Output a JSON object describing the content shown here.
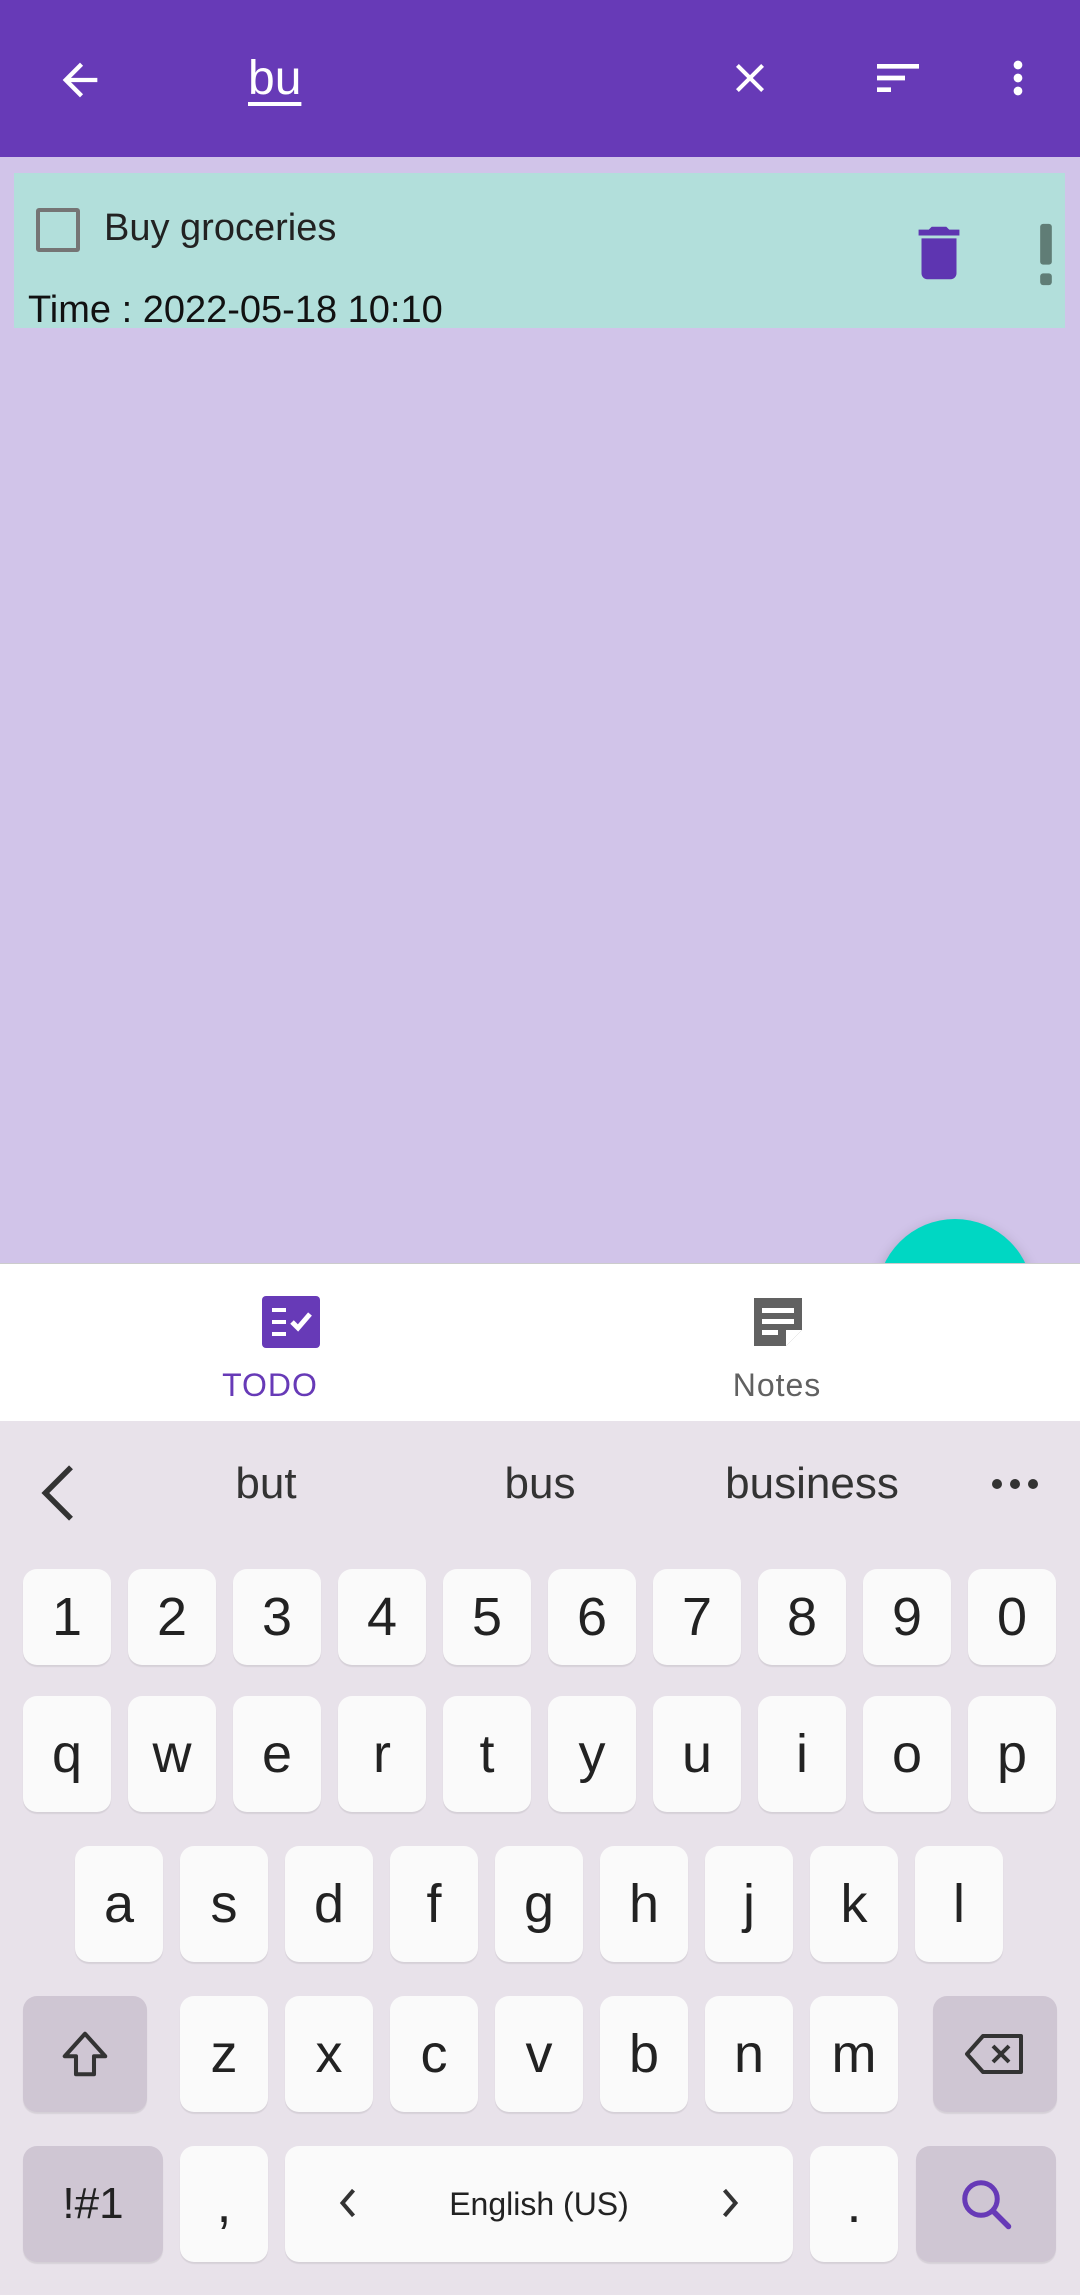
{
  "appbar": {
    "search_query": "bu",
    "icons": [
      "back-arrow-icon",
      "close-icon",
      "sort-icon",
      "more-vert-icon"
    ]
  },
  "todo_items": [
    {
      "title": "Buy groceries",
      "time": "Time : 2022-05-18 10:10",
      "checked": false
    }
  ],
  "bottom_nav": {
    "items": [
      {
        "label": "TODO",
        "active": true,
        "icon": "checklist-icon"
      },
      {
        "label": "Notes",
        "active": false,
        "icon": "note-icon"
      }
    ]
  },
  "keyboard": {
    "suggestions": [
      "but",
      "bus",
      "business"
    ],
    "row_numbers": [
      "1",
      "2",
      "3",
      "4",
      "5",
      "6",
      "7",
      "8",
      "9",
      "0"
    ],
    "row_q": [
      "q",
      "w",
      "e",
      "r",
      "t",
      "y",
      "u",
      "i",
      "o",
      "p"
    ],
    "row_a": [
      "a",
      "s",
      "d",
      "f",
      "g",
      "h",
      "j",
      "k",
      "l"
    ],
    "row_z": [
      "z",
      "x",
      "c",
      "v",
      "b",
      "n",
      "m"
    ],
    "symbols_label": "!#1",
    "comma": ",",
    "period": ".",
    "language_label": "English (US)"
  },
  "colors": {
    "appbar": "#673ab7",
    "background": "#d1c4e9",
    "item": "#b2dfdb",
    "fab": "#00d7c3",
    "accent": "#673ab7"
  }
}
